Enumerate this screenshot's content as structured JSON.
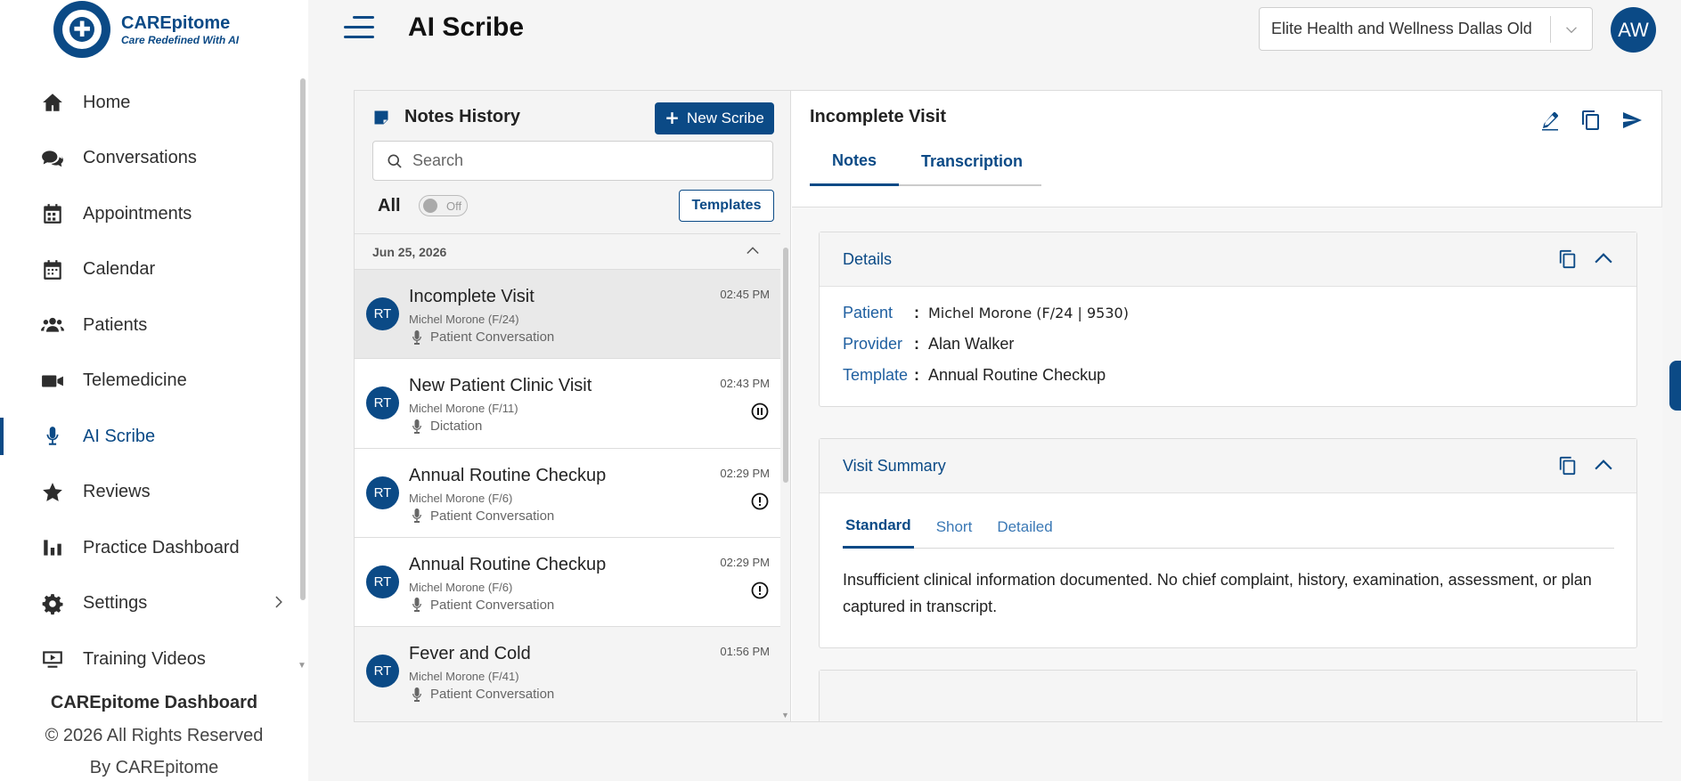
{
  "brand": {
    "name": "CAREpitome",
    "tagline": "Care Redefined With AI"
  },
  "sidebar": {
    "items": [
      {
        "label": "Home",
        "icon": "home-icon"
      },
      {
        "label": "Conversations",
        "icon": "chat-icon"
      },
      {
        "label": "Appointments",
        "icon": "calendar-grid-icon"
      },
      {
        "label": "Calendar",
        "icon": "calendar-icon"
      },
      {
        "label": "Patients",
        "icon": "users-icon"
      },
      {
        "label": "Telemedicine",
        "icon": "video-icon"
      },
      {
        "label": "AI Scribe",
        "icon": "microphone-icon",
        "active": true
      },
      {
        "label": "Reviews",
        "icon": "star-icon"
      },
      {
        "label": "Practice Dashboard",
        "icon": "bar-chart-icon"
      },
      {
        "label": "Settings",
        "icon": "gear-icon"
      },
      {
        "label": "Training Videos",
        "icon": "play-video-icon"
      }
    ],
    "footer": {
      "title": "CAREpitome Dashboard",
      "copyright": "© 2026 All Rights Reserved",
      "by": "By CAREpitome"
    }
  },
  "header": {
    "title": "AI Scribe",
    "organization": "Elite Health and Wellness Dallas Old",
    "user_initials": "AW"
  },
  "notes_history": {
    "title": "Notes History",
    "new_button": "New Scribe",
    "search_placeholder": "Search",
    "filter_label": "All",
    "toggle_text": "Off",
    "templates_button": "Templates",
    "date_group": "Jun 25, 2026",
    "items": [
      {
        "initials": "RT",
        "title": "Incomplete Visit",
        "patient": "Michel Morone (F/24)",
        "type": "Patient Conversation",
        "time": "02:45 PM",
        "status": "none",
        "selected": true
      },
      {
        "initials": "RT",
        "title": "New Patient Clinic Visit",
        "patient": "Michel Morone (F/11)",
        "type": "Dictation",
        "time": "02:43 PM",
        "status": "paused"
      },
      {
        "initials": "RT",
        "title": "Annual Routine Checkup",
        "patient": "Michel Morone (F/6)",
        "type": "Patient Conversation",
        "time": "02:29 PM",
        "status": "alert"
      },
      {
        "initials": "RT",
        "title": "Annual Routine Checkup",
        "patient": "Michel Morone (F/6)",
        "type": "Patient Conversation",
        "time": "02:29 PM",
        "status": "alert"
      },
      {
        "initials": "RT",
        "title": "Fever and Cold",
        "patient": "Michel Morone (F/41)",
        "type": "Patient Conversation",
        "time": "01:56 PM",
        "status": "none"
      }
    ]
  },
  "detail": {
    "title": "Incomplete Visit",
    "tabs": [
      "Notes",
      "Transcription"
    ],
    "details_card": {
      "heading": "Details",
      "rows": [
        {
          "key": "Patient",
          "value": "Michel Morone (F/24 | 9530)"
        },
        {
          "key": "Provider",
          "value": "Alan Walker"
        },
        {
          "key": "Template",
          "value": "Annual Routine Checkup"
        }
      ]
    },
    "summary_card": {
      "heading": "Visit Summary",
      "tabs": [
        "Standard",
        "Short",
        "Detailed"
      ],
      "text": "Insufficient clinical information documented. No chief complaint, history, examination, assessment, or plan captured in transcript."
    }
  }
}
